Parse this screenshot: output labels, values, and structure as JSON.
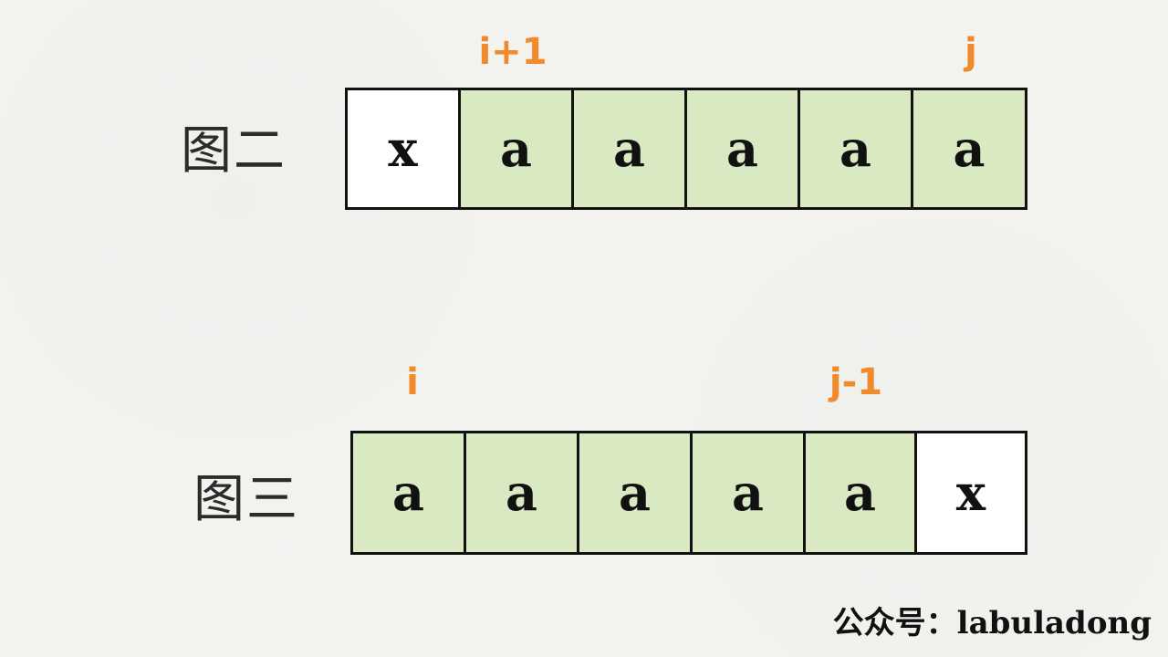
{
  "figure2": {
    "label": "图二",
    "pointers": [
      "i+1",
      "j"
    ],
    "cells": [
      {
        "text": "x",
        "color": "white"
      },
      {
        "text": "a",
        "color": "green"
      },
      {
        "text": "a",
        "color": "green"
      },
      {
        "text": "a",
        "color": "green"
      },
      {
        "text": "a",
        "color": "green"
      },
      {
        "text": "a",
        "color": "green"
      }
    ]
  },
  "figure3": {
    "label": "图三",
    "pointers": [
      "i",
      "j-1"
    ],
    "cells": [
      {
        "text": "a",
        "color": "green"
      },
      {
        "text": "a",
        "color": "green"
      },
      {
        "text": "a",
        "color": "green"
      },
      {
        "text": "a",
        "color": "green"
      },
      {
        "text": "a",
        "color": "green"
      },
      {
        "text": "x",
        "color": "white"
      }
    ]
  },
  "colors": {
    "pointer": "#f08a2c",
    "green_cell": "#d9eac3",
    "white_cell": "#ffffff"
  },
  "watermark": "公众号：labuladong"
}
